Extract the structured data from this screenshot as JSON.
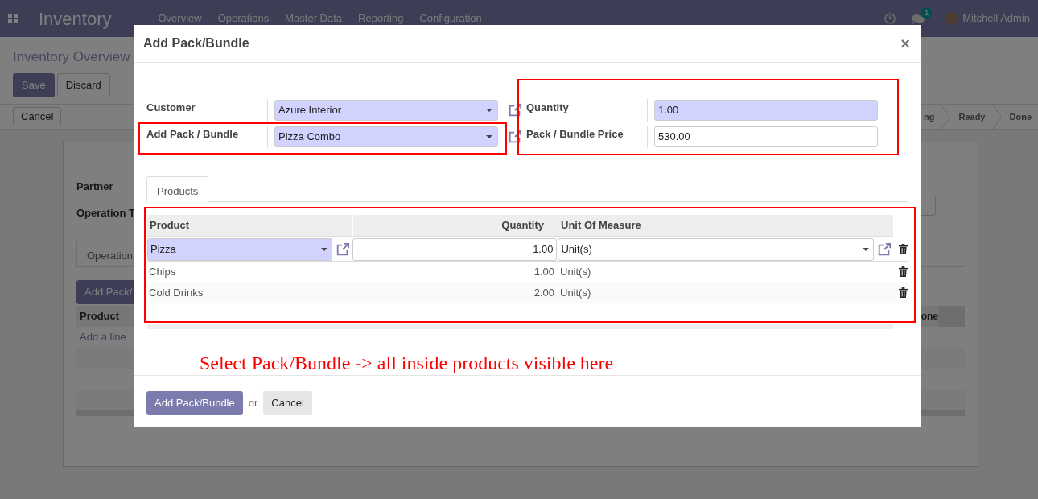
{
  "navbar": {
    "app_title": "Inventory",
    "menu": [
      "Overview",
      "Operations",
      "Master Data",
      "Reporting",
      "Configuration"
    ],
    "message_count": "1",
    "user": "Mitchell Admin"
  },
  "background": {
    "breadcrumb": "Inventory Overview",
    "buttons": [
      {
        "label": "Save",
        "kind": "primary"
      },
      {
        "label": "Discard",
        "kind": "secondary"
      }
    ],
    "cancel": "Cancel",
    "stages": [
      "ng",
      "Ready",
      "Done"
    ],
    "fields": [
      "Partner",
      "Operation T"
    ],
    "tab": "Operation",
    "add_button": "Add Pack/",
    "columns": [
      "Product",
      "one"
    ],
    "add_line": "Add a line"
  },
  "dialog": {
    "title": "Add Pack/Bundle",
    "close": "×",
    "left_group": [
      {
        "label": "Customer",
        "value": "Azure Interior",
        "kind": "select",
        "required": true
      },
      {
        "label": "Add Pack / Bundle",
        "value": "Pizza Combo",
        "kind": "select",
        "required": true
      }
    ],
    "right_group": [
      {
        "label": "Quantity",
        "value": "1.00",
        "kind": "text",
        "required": true
      },
      {
        "label": "Pack / Bundle Price",
        "value": "530.00",
        "kind": "text",
        "required": false
      }
    ],
    "tabs": [
      {
        "label": "Products",
        "selected": true
      }
    ],
    "table": {
      "columns": [
        "Product",
        "Quantity",
        "Unit Of Measure"
      ],
      "rows": [
        {
          "product": "Pizza",
          "quantity": "1.00",
          "uom": "Unit(s)",
          "editing": true
        },
        {
          "product": "Chips",
          "quantity": "1.00",
          "uom": "Unit(s)",
          "editing": false
        },
        {
          "product": "Cold Drinks",
          "quantity": "2.00",
          "uom": "Unit(s)",
          "editing": false
        }
      ]
    },
    "footer": {
      "primary": "Add Pack/Bundle",
      "separator": "or",
      "cancel": "Cancel"
    }
  },
  "annotation": "Select Pack/Bundle -> all inside products visible here"
}
